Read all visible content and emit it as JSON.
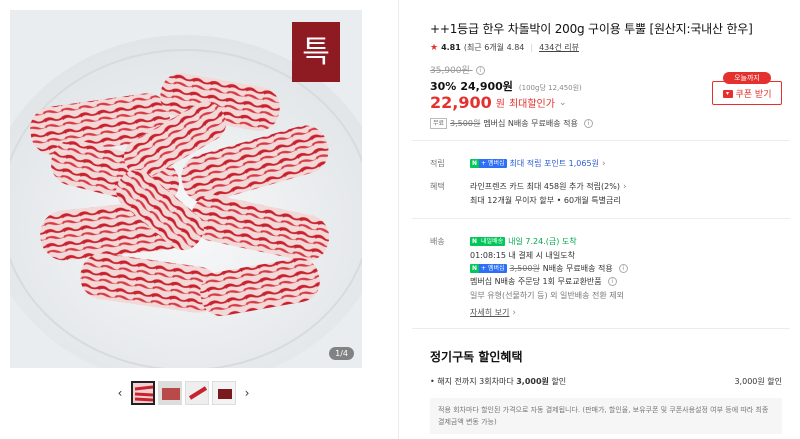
{
  "gallery": {
    "counter": "1/4",
    "logo_char": "특",
    "prev_arrow": "‹",
    "next_arrow": "›",
    "thumbnail_count": 4
  },
  "product": {
    "title": "++1등급 한우 차돌박이 200g 구이용 투뿔 [원산지:국내산 한우]",
    "rating_score": "4.81",
    "rating_recent": "(최근 6개월 4.84",
    "review_count": "434건 리뷰",
    "original_price": "35,900원",
    "discount_rate": "30%",
    "sale_price": "24,900원",
    "unit_price": "(100g당 12,450원)",
    "max_discount_price": "22,900",
    "max_discount_won": "원",
    "max_discount_label": "최대할인가",
    "coupon_badge": "오늘까지",
    "coupon_button": "쿠폰 받기",
    "shipping_badge": "무료",
    "shipping_old": "3,500원",
    "shipping_text": "멤버십 N배송 무료배송 적용"
  },
  "benefits": {
    "points_label": "적립",
    "points_text": "최대 적립 포인트 1,065원",
    "card_label": "혜택",
    "card_line1": "라인프렌즈 카드 최대 458원 추가 적립(2%)",
    "card_line2": "최대 12개월 무이자 할부 • 60개월 특별금리"
  },
  "delivery": {
    "label": "배송",
    "badge": "내일배송",
    "eta": "내일 7.24.(금) 도착",
    "cutoff": "01:08:15  내 결제 시 내일도착",
    "fee_old": "3,500원",
    "fee_text": "N배송 무료배송 적용",
    "return_text": "멤버십 N배송 주문당 1회 무료교환반품",
    "exclude_text": "일부 유형(선물하기 등) 외 일반배송 전환 제외",
    "more_link": "자세히 보기"
  },
  "subscription": {
    "title": "정기구독 할인혜택",
    "row_prefix": "• 해지 전까지 3회차마다 ",
    "row_amount": "3,000원",
    "row_suffix": " 할인",
    "row_right": "3,000원 할인",
    "note": "적용 회차마다 할인된 가격으로 자동 결제됩니다. (판매가, 할인율, 보유쿠폰 및 쿠폰사용설정 여부 등에 따라 최종 결제금액 변동 가능)"
  },
  "colors": {
    "accent": "#e4312d",
    "npay_green": "#03c75a",
    "link_blue": "#2d5bd2"
  }
}
